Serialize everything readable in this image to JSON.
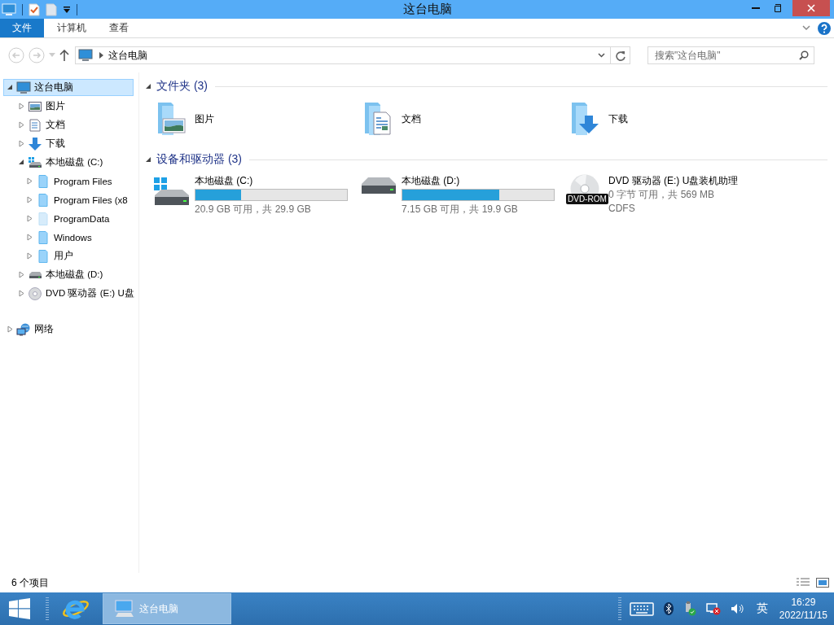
{
  "window": {
    "title": "这台电脑"
  },
  "ribbon": {
    "tabs": [
      {
        "label": "文件",
        "selected": true
      },
      {
        "label": "计算机",
        "selected": false
      },
      {
        "label": "查看",
        "selected": false
      }
    ]
  },
  "address_bar": {
    "path": [
      "这台电脑"
    ]
  },
  "search": {
    "placeholder": "搜索\"这台电脑\""
  },
  "sidebar": {
    "items": [
      {
        "kind": "computer",
        "label": "这台电脑",
        "expanded": true,
        "selected": true,
        "children": [
          {
            "kind": "pictures",
            "label": "图片",
            "expanded": false,
            "selected": false
          },
          {
            "kind": "documents",
            "label": "文档",
            "expanded": false,
            "selected": false
          },
          {
            "kind": "downloads",
            "label": "下载",
            "expanded": false,
            "selected": false
          },
          {
            "kind": "system_drive",
            "label": "本地磁盘 (C:)",
            "expanded": true,
            "selected": false,
            "children": [
              {
                "kind": "folder",
                "label": "Program Files",
                "expanded": false,
                "selected": false,
                "hidden": false
              },
              {
                "kind": "folder",
                "label": "Program Files (x8",
                "expanded": false,
                "selected": false,
                "hidden": false
              },
              {
                "kind": "folder",
                "label": "ProgramData",
                "expanded": false,
                "selected": false,
                "hidden": true
              },
              {
                "kind": "folder",
                "label": "Windows",
                "expanded": false,
                "selected": false,
                "hidden": false
              },
              {
                "kind": "folder",
                "label": "用户",
                "expanded": false,
                "selected": false,
                "hidden": false
              }
            ]
          },
          {
            "kind": "drive",
            "label": "本地磁盘 (D:)",
            "expanded": false,
            "selected": false
          },
          {
            "kind": "dvd",
            "label": "DVD 驱动器 (E:) U盘",
            "expanded": false,
            "selected": false
          }
        ]
      },
      {
        "kind": "network",
        "label": "网络",
        "expanded": false,
        "selected": false
      }
    ]
  },
  "content": {
    "groups": [
      {
        "title": "文件夹 (3)",
        "expanded": true,
        "items": [
          {
            "kind": "pictures",
            "name": "图片"
          },
          {
            "kind": "documents",
            "name": "文档"
          },
          {
            "kind": "downloads",
            "name": "下载"
          }
        ]
      },
      {
        "title": "设备和驱动器 (3)",
        "expanded": true,
        "items": [
          {
            "kind": "system_drive",
            "name": "本地磁盘 (C:)",
            "level": 0.3,
            "detail": "20.9 GB 可用，共 29.9 GB"
          },
          {
            "kind": "drive",
            "name": "本地磁盘 (D:)",
            "level": 0.64,
            "detail": "7.15 GB 可用，共 19.9 GB"
          },
          {
            "kind": "dvd",
            "name": "DVD 驱动器 (E:) U盘装机助理",
            "badge": "DVD-ROM",
            "detail": "0 字节 可用，共 569 MB",
            "filesystem": "CDFS"
          }
        ]
      }
    ]
  },
  "status_bar": {
    "item_count": "6 个项目"
  },
  "taskbar": {
    "tasks": [
      {
        "label": "这台电脑",
        "selected": true
      }
    ],
    "input_method": "英",
    "time": "16:29",
    "date": "2022/11/15"
  }
}
